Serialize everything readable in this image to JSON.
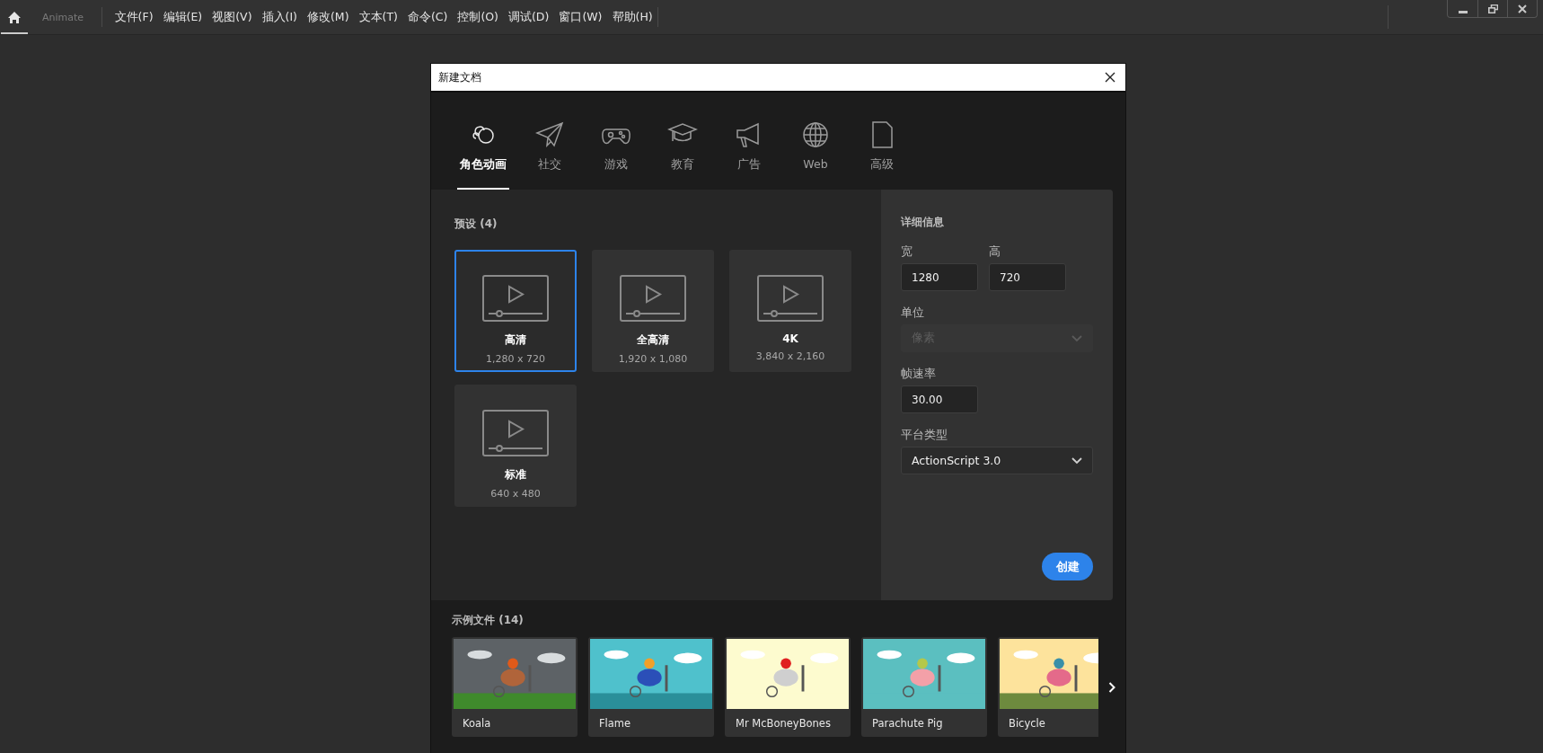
{
  "app": {
    "name": "Animate"
  },
  "menu": [
    "文件(F)",
    "编辑(E)",
    "视图(V)",
    "插入(I)",
    "修改(M)",
    "文本(T)",
    "命令(C)",
    "控制(O)",
    "调试(D)",
    "窗口(W)",
    "帮助(H)"
  ],
  "dialog": {
    "title": "新建文档",
    "categories": [
      {
        "label": "角色动画",
        "selected": true
      },
      {
        "label": "社交",
        "selected": false
      },
      {
        "label": "游戏",
        "selected": false
      },
      {
        "label": "教育",
        "selected": false
      },
      {
        "label": "广告",
        "selected": false
      },
      {
        "label": "Web",
        "selected": false
      },
      {
        "label": "高级",
        "selected": false
      }
    ],
    "presets": {
      "title": "预设 (4)",
      "items": [
        {
          "name": "高清",
          "size": "1,280 x 720",
          "selected": true
        },
        {
          "name": "全高清",
          "size": "1,920 x 1,080",
          "selected": false
        },
        {
          "name": "4K",
          "size": "3,840 x 2,160",
          "selected": false
        },
        {
          "name": "标准",
          "size": "640 x 480",
          "selected": false
        }
      ]
    },
    "details": {
      "title": "详细信息",
      "width": {
        "label": "宽",
        "value": "1280"
      },
      "height": {
        "label": "高",
        "value": "720"
      },
      "unit": {
        "label": "单位",
        "value": "像素",
        "disabled": true
      },
      "frame_rate": {
        "label": "帧速率",
        "value": "30.00"
      },
      "platform": {
        "label": "平台类型",
        "value": "ActionScript 3.0",
        "disabled": false
      },
      "create_button": "创建"
    },
    "samples": {
      "title": "示例文件 (14)",
      "items": [
        {
          "name": "Koala"
        },
        {
          "name": "Flame"
        },
        {
          "name": "Mr McBoneyBones"
        },
        {
          "name": "Parachute Pig"
        },
        {
          "name": "Bicycle"
        }
      ]
    }
  }
}
